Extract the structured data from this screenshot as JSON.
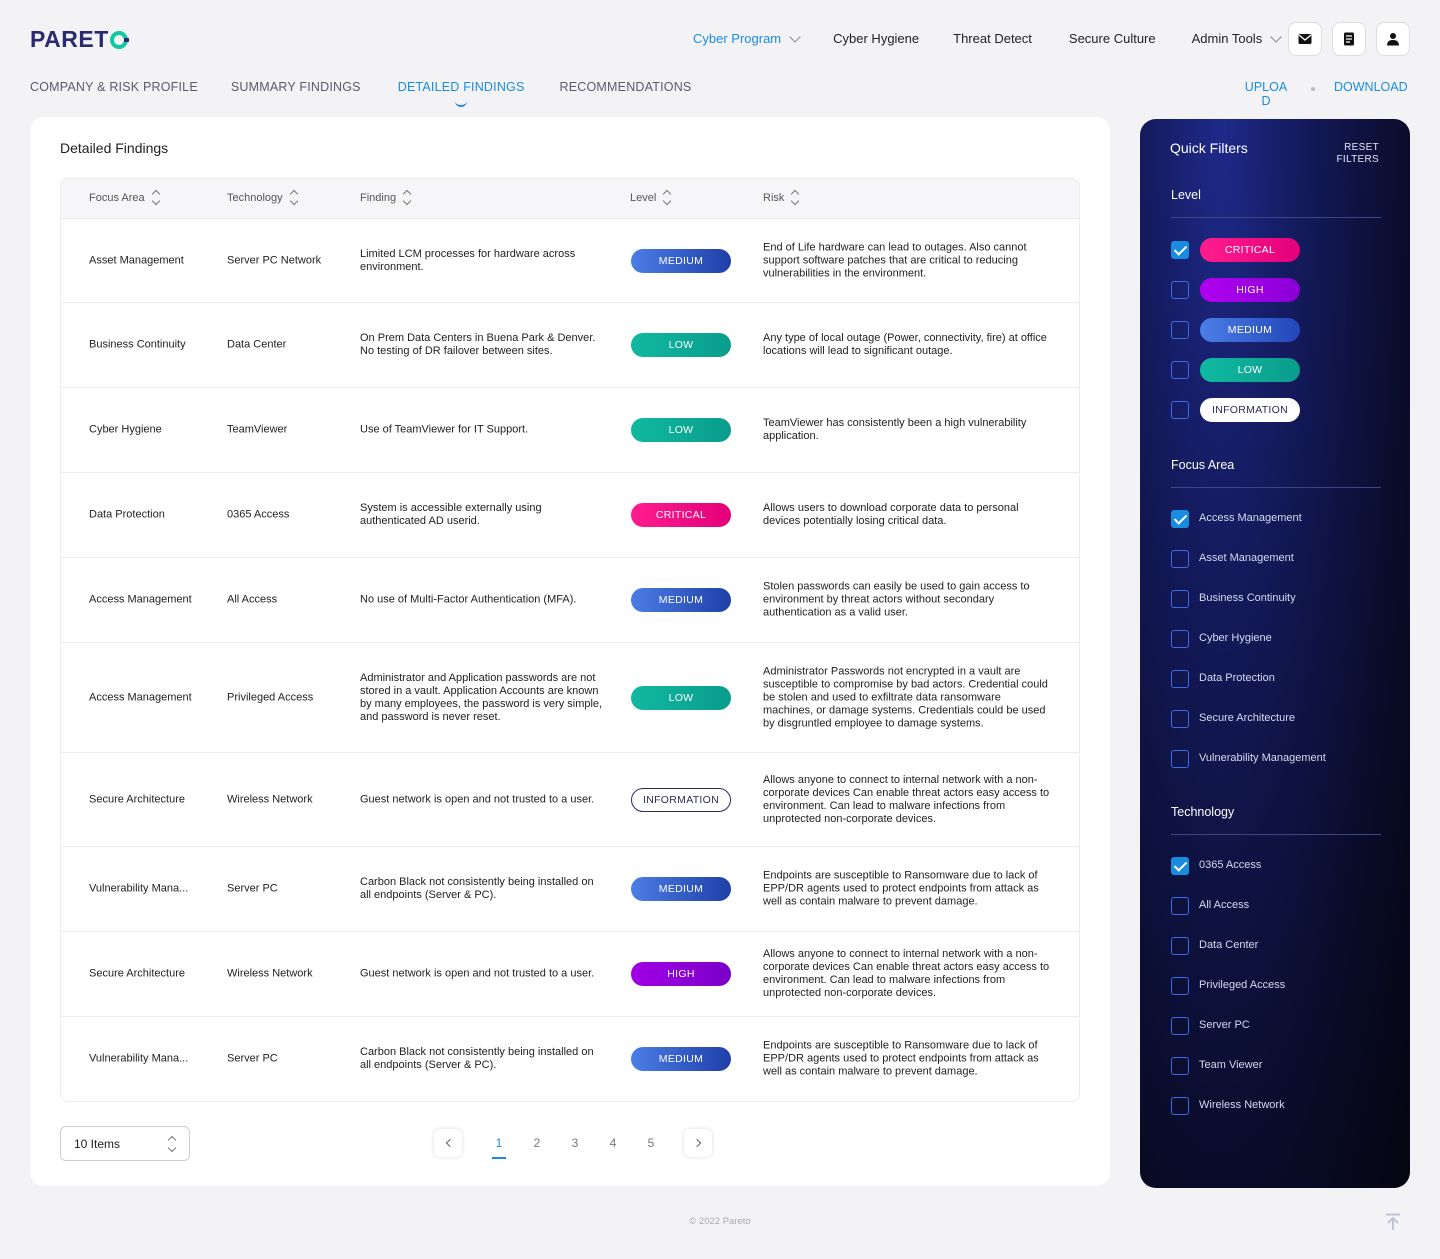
{
  "brand": {
    "logo_text": "PARET"
  },
  "topnav": [
    {
      "label": "Cyber Program",
      "active": true,
      "dropdown": true
    },
    {
      "label": "Cyber Hygiene",
      "active": false,
      "dropdown": false
    },
    {
      "label": "Threat Detect",
      "active": false,
      "dropdown": false
    },
    {
      "label": "Secure Culture",
      "active": false,
      "dropdown": false
    },
    {
      "label": "Admin Tools",
      "active": false,
      "dropdown": true
    }
  ],
  "header_icons": [
    "mail-icon",
    "document-icon",
    "user-icon"
  ],
  "subnav": [
    {
      "label": "COMPANY & RISK PROFILE",
      "active": false
    },
    {
      "label": "SUMMARY FINDINGS",
      "active": false
    },
    {
      "label": "DETAILED FINDINGS",
      "active": true
    },
    {
      "label": "RECOMMENDATIONS",
      "active": false
    }
  ],
  "actions": {
    "upload": "UPLOAD",
    "download": "DOWNLOAD"
  },
  "card": {
    "title": "Detailed Findings"
  },
  "columns": [
    "Focus Area",
    "Technology",
    "Finding",
    "Level",
    "Risk"
  ],
  "rows": [
    {
      "focus": "Asset Management",
      "tech": "Server PC Network",
      "finding": "Limited LCM processes for hardware across environment.",
      "level": "MEDIUM",
      "level_class": "medium",
      "risk": "End of Life hardware can lead to outages. Also cannot support software patches that are critical to reducing vulnerabilities in the environment."
    },
    {
      "focus": "Business Continuity",
      "tech": "Data Center",
      "finding": "On Prem Data Centers in Buena Park & Denver. No testing of DR failover between sites.",
      "level": "LOW",
      "level_class": "low",
      "risk": "Any type of local outage (Power, connectivity, fire) at office locations will lead to significant outage."
    },
    {
      "focus": "Cyber Hygiene",
      "tech": "TeamViewer",
      "finding": "Use of TeamViewer for IT Support.",
      "level": "LOW",
      "level_class": "low",
      "risk": "TeamViewer has consistently been a high vulnerability application."
    },
    {
      "focus": "Data Protection",
      "tech": "0365 Access",
      "finding": "System is accessible externally using authenticated AD userid.",
      "level": "CRITICAL",
      "level_class": "critical",
      "risk": "Allows users to download corporate data to personal devices potentially losing critical data."
    },
    {
      "focus": "Access Management",
      "tech": "All Access",
      "finding": "No use of Multi-Factor Authentication (MFA).",
      "level": "MEDIUM",
      "level_class": "medium",
      "risk": "Stolen passwords can easily be used to gain access to environment by threat actors without secondary authentication as a valid user."
    },
    {
      "focus": "Access Management",
      "tech": "Privileged Access",
      "finding": "Administrator and Application passwords are not stored in a vault. Application Accounts are known by many employees, the password is very simple, and password is never reset.",
      "level": "LOW",
      "level_class": "low",
      "risk": "Administrator Passwords not encrypted in a vault are susceptible to compromise by bad actors. Credential could be stolen and used to exfiltrate data ransomware machines, or damage systems. Credentials could be used by disgruntled employee to damage systems."
    },
    {
      "focus": "Secure Architecture",
      "tech": "Wireless Network",
      "finding": "Guest network is open and not trusted to a user.",
      "level": "INFORMATION",
      "level_class": "info",
      "risk": "Allows anyone to connect to internal network with a non-corporate devices Can enable threat actors easy access to environment. Can lead to malware infections from unprotected non-corporate devices."
    },
    {
      "focus": "Vulnerability Mana...",
      "tech": "Server PC",
      "finding": "Carbon Black not consistently being installed on all endpoints (Server & PC).",
      "level": "MEDIUM",
      "level_class": "medium",
      "risk": "Endpoints are susceptible to Ransomware due to lack of EPP/DR agents used to protect endpoints from attack as well as contain malware to prevent damage."
    },
    {
      "focus": "Secure Architecture",
      "tech": "Wireless Network",
      "finding": "Guest network is open and not trusted to a user.",
      "level": "HIGH",
      "level_class": "high",
      "risk": "Allows anyone to connect to internal network with a non-corporate devices Can enable threat actors easy access to environment. Can lead to malware infections from unprotected non-corporate devices."
    },
    {
      "focus": "Vulnerability Mana...",
      "tech": "Server PC",
      "finding": "Carbon Black not consistently being installed on all endpoints (Server & PC).",
      "level": "MEDIUM",
      "level_class": "medium",
      "risk": "Endpoints are susceptible to Ransomware due to lack of EPP/DR agents used to protect endpoints from attack as well as contain malware to prevent damage."
    }
  ],
  "pagination": {
    "items_label": "10 Items",
    "pages": [
      "1",
      "2",
      "3",
      "4",
      "5"
    ],
    "current": "1"
  },
  "filters": {
    "title": "Quick Filters",
    "reset": "RESET FILTERS",
    "level": {
      "title": "Level",
      "options": [
        {
          "label": "CRITICAL",
          "class": "critical",
          "checked": true
        },
        {
          "label": "HIGH",
          "class": "high",
          "checked": false
        },
        {
          "label": "MEDIUM",
          "class": "medium",
          "checked": false
        },
        {
          "label": "LOW",
          "class": "low",
          "checked": false
        },
        {
          "label": "INFORMATION",
          "class": "info",
          "checked": false
        }
      ]
    },
    "focus": {
      "title": "Focus Area",
      "options": [
        {
          "label": "Access Management",
          "checked": true
        },
        {
          "label": "Asset Management",
          "checked": false
        },
        {
          "label": "Business Continuity",
          "checked": false
        },
        {
          "label": "Cyber Hygiene",
          "checked": false
        },
        {
          "label": "Data Protection",
          "checked": false
        },
        {
          "label": "Secure Architecture",
          "checked": false
        },
        {
          "label": "Vulnerability Management",
          "checked": false
        }
      ]
    },
    "technology": {
      "title": "Technology",
      "options": [
        {
          "label": "0365 Access",
          "checked": true
        },
        {
          "label": "All Access",
          "checked": false
        },
        {
          "label": "Data Center",
          "checked": false
        },
        {
          "label": "Privileged Access",
          "checked": false
        },
        {
          "label": "Server PC",
          "checked": false
        },
        {
          "label": "Team Viewer",
          "checked": false
        },
        {
          "label": "Wireless Network",
          "checked": false
        }
      ]
    }
  },
  "footer": "© 2022 Pareto",
  "colors": {
    "accent": "#1a8ce0",
    "brand": "#2a2a6e",
    "logo_ring": "#14c6a1"
  }
}
